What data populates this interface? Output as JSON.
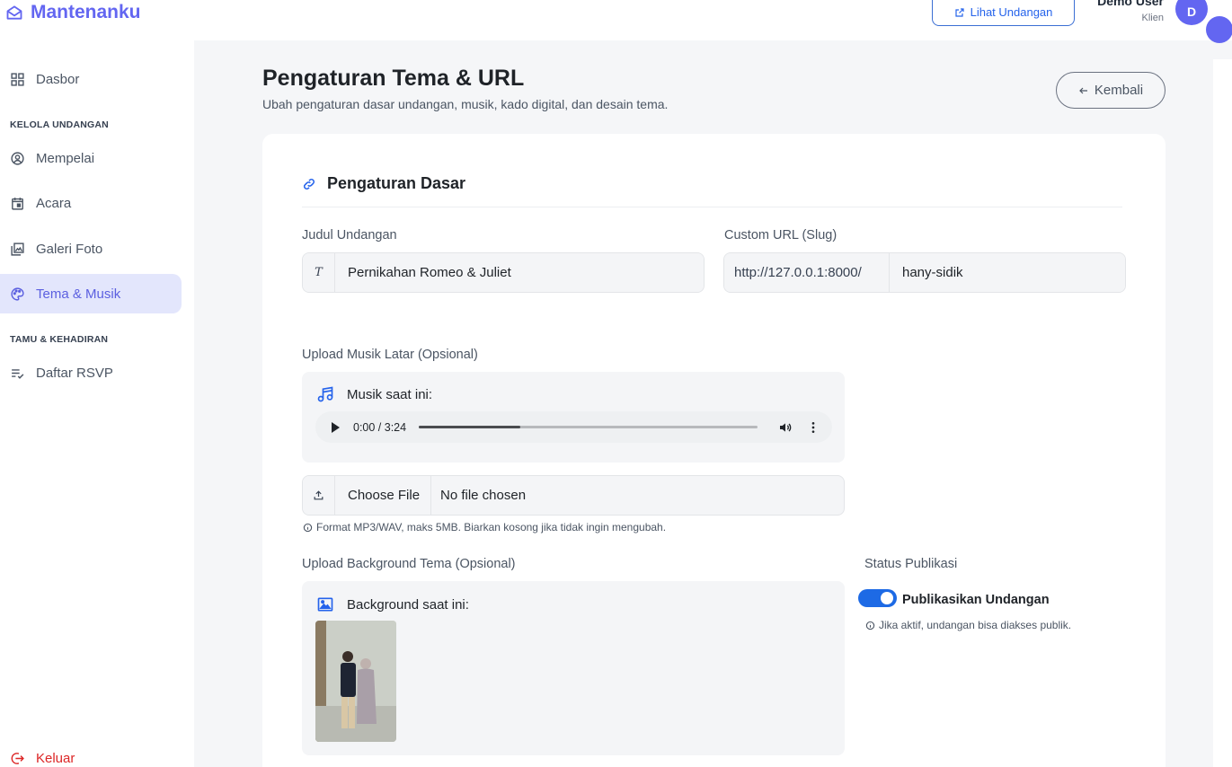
{
  "brand": {
    "name": "Mantenanku"
  },
  "sidebar": {
    "dashboard": "Dasbor",
    "section_manage": "KELOLA UNDANGAN",
    "couple": "Mempelai",
    "event": "Acara",
    "gallery": "Galeri Foto",
    "theme_music": "Tema & Musik",
    "section_guest": "TAMU & KEHADIRAN",
    "rsvp": "Daftar RSVP",
    "logout": "Keluar"
  },
  "topbar": {
    "view_invitation": "Lihat Undangan",
    "user_name": "Demo User",
    "user_role": "Klien",
    "avatar_initial": "D"
  },
  "header": {
    "title": "Pengaturan Tema & URL",
    "subtitle": "Ubah pengaturan dasar undangan, musik, kado digital, dan desain tema.",
    "back": "Kembali"
  },
  "basic": {
    "section_title": "Pengaturan Dasar",
    "title_label": "Judul Undangan",
    "title_icon": "T",
    "title_value": "Pernikahan Romeo & Juliet",
    "slug_label": "Custom URL (Slug)",
    "slug_prefix": "http://127.0.0.1:8000/",
    "slug_value": "hany-sidik"
  },
  "music": {
    "label": "Upload Musik Latar (Opsional)",
    "current": "Musik saat ini:",
    "time": "0:00 / 3:24",
    "progress": 0.3,
    "choose_file": "Choose File",
    "no_file": "No file chosen",
    "hint": "Format MP3/WAV, maks 5MB. Biarkan kosong jika tidak ingin mengubah."
  },
  "background": {
    "label": "Upload Background Tema (Opsional)",
    "current": "Background saat ini:"
  },
  "publish": {
    "label": "Status Publikasi",
    "toggle_label": "Publikasikan Undangan",
    "enabled": true,
    "hint": "Jika aktif, undangan bisa diakses publik."
  },
  "colors": {
    "accent": "#6366f1",
    "primary_blue": "#2563eb",
    "toggle_blue": "#1d6ae5",
    "danger": "#dc2626"
  }
}
